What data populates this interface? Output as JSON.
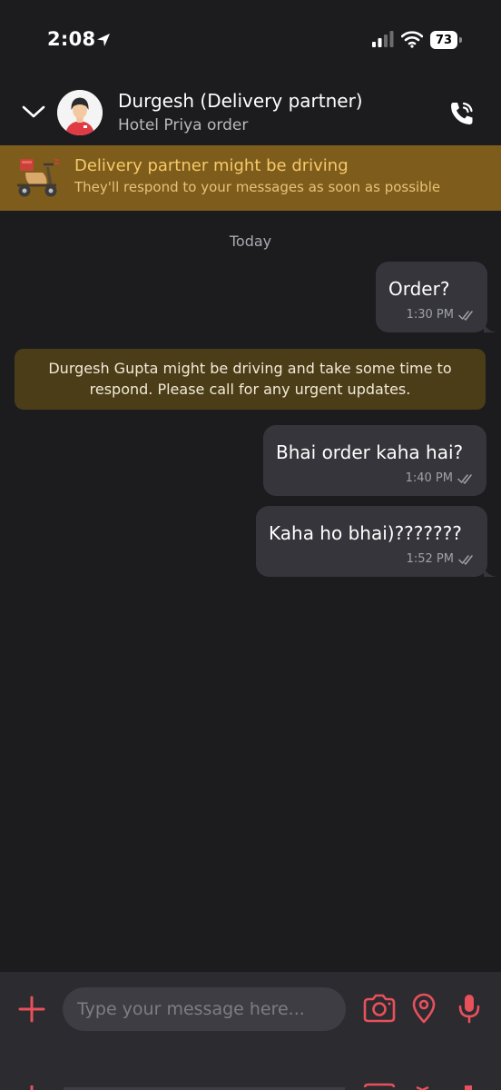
{
  "status_bar": {
    "time": "2:08",
    "battery": "73"
  },
  "header": {
    "partner_name": "Durgesh (Delivery partner)",
    "order_name": "Hotel Priya order"
  },
  "banner": {
    "title": "Delivery partner might be driving",
    "subtitle": "They'll respond to your messages as soon as possible"
  },
  "chat": {
    "date_label": "Today",
    "messages": [
      {
        "text": "Order?",
        "time": "1:30 PM"
      },
      {
        "text": "Bhai order kaha hai?",
        "time": "1:40 PM"
      },
      {
        "text": "Kaha ho bhai)???????",
        "time": "1:52 PM"
      }
    ],
    "notice": "Durgesh Gupta might be driving and take some time to respond. Please call for any urgent updates."
  },
  "composer": {
    "placeholder": "Type your message here..."
  },
  "colors": {
    "accent": "#e8505b",
    "background": "#1c1c1f",
    "banner_bg": "#7e5c1b",
    "bubble_bg": "#35353b",
    "notice_bg": "#4b3d18"
  },
  "icons": [
    "location-arrow-icon",
    "signal-icon",
    "wifi-icon",
    "battery-icon",
    "chevron-down-icon",
    "call-icon",
    "scooter-icon",
    "double-check-icon",
    "plus-icon",
    "camera-icon",
    "location-pin-icon",
    "microphone-icon"
  ]
}
